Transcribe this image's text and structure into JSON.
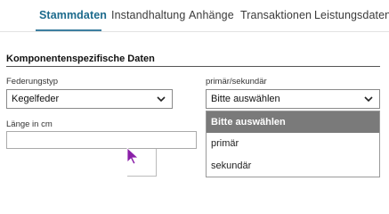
{
  "tabs": [
    {
      "label": "Stammdaten",
      "active": true
    },
    {
      "label": "Instandhaltung",
      "active": false
    },
    {
      "label": "Anhänge",
      "active": false
    },
    {
      "label": "Transaktionen",
      "active": false
    },
    {
      "label": "Leistungsdaten",
      "active": false
    }
  ],
  "section": {
    "title": "Komponentenspezifische Daten"
  },
  "fields": {
    "federungstyp": {
      "label": "Federungstyp",
      "value": "Kegelfeder"
    },
    "primaer_sekundaer": {
      "label": "primär/sekundär",
      "value": "Bitte auswählen",
      "options": [
        "Bitte auswählen",
        "primär",
        "sekundär"
      ],
      "highlighted": "Bitte auswählen"
    },
    "laenge": {
      "label": "Länge in cm",
      "value": ""
    }
  },
  "colors": {
    "accent": "#1c6a8c",
    "highlight": "#7a7a7a",
    "cursor": "#8a1fa8"
  },
  "icons": {
    "select_arrow": "chevron-down-icon",
    "pointer": "mouse-pointer-icon"
  }
}
